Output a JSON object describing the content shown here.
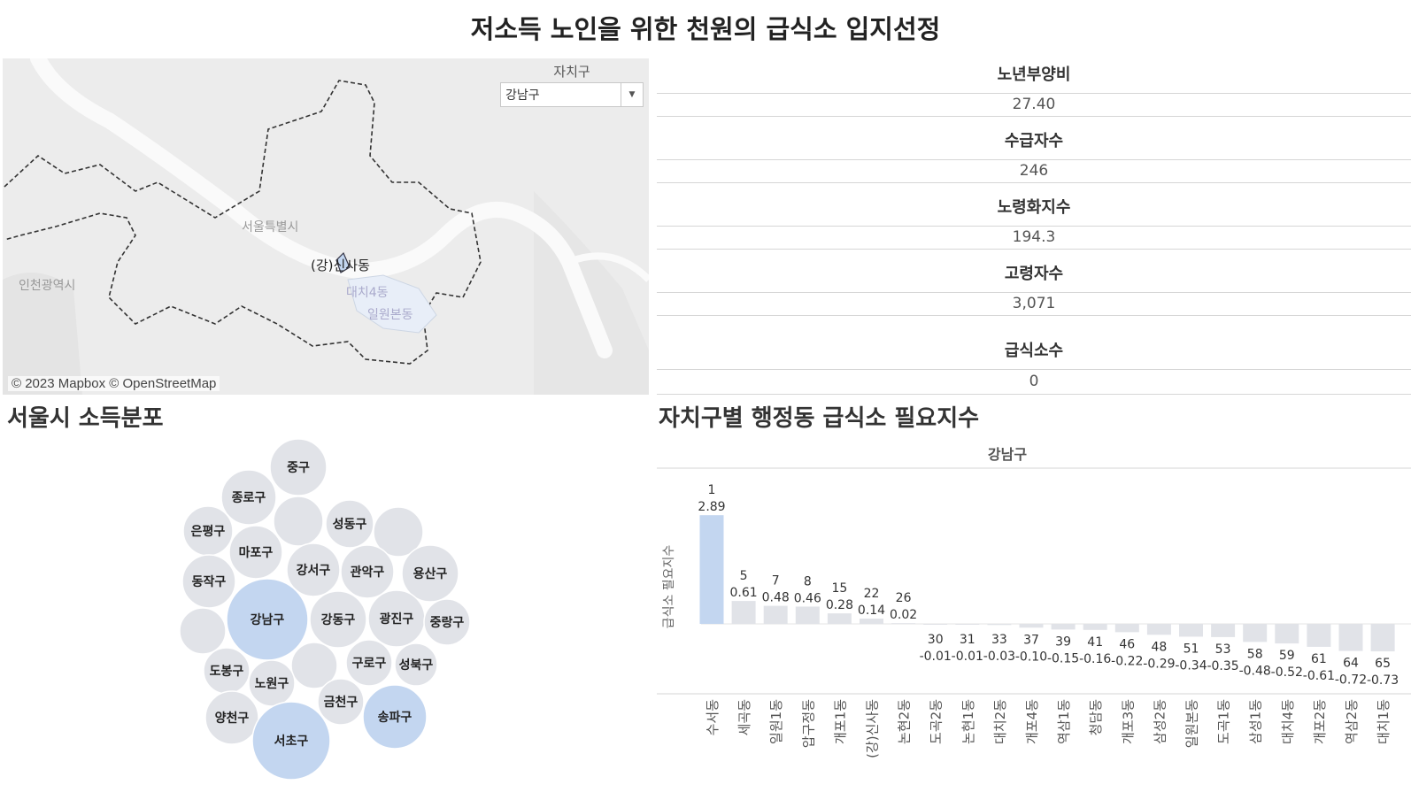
{
  "title": "저소득 노인을 위한 천원의 급식소 입지선정",
  "map": {
    "attribution": "© 2023 Mapbox © OpenStreetMap",
    "labels": {
      "seoul": "서울특별시",
      "incheon": "인천광역시",
      "selected": "(강)신사동",
      "daechi": "대치4동",
      "irwon": "일원본동"
    },
    "filter": {
      "label": "자치구",
      "value": "강남구"
    }
  },
  "stats": [
    {
      "label": "노년부양비",
      "value": "27.40"
    },
    {
      "label": "수급자수",
      "value": "246"
    },
    {
      "label": "노령화지수",
      "value": "194.3"
    },
    {
      "label": "고령자수",
      "value": "3,071"
    },
    {
      "label": "급식소수",
      "value": "0"
    }
  ],
  "bubble_title": "서울시 소득분포",
  "bubbles": [
    {
      "name": "중구",
      "highlight": false
    },
    {
      "name": "종로구",
      "highlight": false
    },
    {
      "name": "",
      "highlight": false
    },
    {
      "name": "성동구",
      "highlight": false
    },
    {
      "name": "",
      "highlight": false
    },
    {
      "name": "은평구",
      "highlight": false
    },
    {
      "name": "마포구",
      "highlight": false
    },
    {
      "name": "강서구",
      "highlight": false
    },
    {
      "name": "관악구",
      "highlight": false
    },
    {
      "name": "용산구",
      "highlight": false
    },
    {
      "name": "동작구",
      "highlight": false
    },
    {
      "name": "강남구",
      "highlight": true
    },
    {
      "name": "강동구",
      "highlight": false
    },
    {
      "name": "광진구",
      "highlight": false
    },
    {
      "name": "중랑구",
      "highlight": false
    },
    {
      "name": "",
      "highlight": false
    },
    {
      "name": "",
      "highlight": false
    },
    {
      "name": "구로구",
      "highlight": false
    },
    {
      "name": "성북구",
      "highlight": false
    },
    {
      "name": "도봉구",
      "highlight": false
    },
    {
      "name": "노원구",
      "highlight": false
    },
    {
      "name": "금천구",
      "highlight": false
    },
    {
      "name": "양천구",
      "highlight": false
    },
    {
      "name": "송파구",
      "highlight": true
    },
    {
      "name": "서초구",
      "highlight": true
    }
  ],
  "chart_title": "자치구별 행정동 급식소 필요지수",
  "chart_data": {
    "type": "bar",
    "panel_header": "강남구",
    "ylabel": "급식소 필요지수",
    "categories": [
      "수서동",
      "세곡동",
      "일원1동",
      "압구정동",
      "개포1동",
      "(강)신사동",
      "논현2동",
      "도곡2동",
      "논현1동",
      "대치2동",
      "개포4동",
      "역삼1동",
      "청담동",
      "개포3동",
      "삼성2동",
      "일원본동",
      "도곡1동",
      "삼성1동",
      "대치4동",
      "개포2동",
      "역삼2동",
      "대치1동"
    ],
    "ranks": [
      1,
      5,
      7,
      8,
      15,
      22,
      26,
      30,
      31,
      33,
      37,
      39,
      41,
      46,
      48,
      51,
      53,
      58,
      59,
      61,
      64,
      65
    ],
    "values": [
      2.89,
      0.61,
      0.48,
      0.46,
      0.28,
      0.14,
      0.02,
      -0.01,
      -0.01,
      -0.03,
      -0.1,
      -0.15,
      -0.16,
      -0.22,
      -0.29,
      -0.34,
      -0.35,
      -0.48,
      -0.52,
      -0.61,
      -0.72,
      -0.73
    ],
    "value_labels": [
      "2.89",
      "0.61",
      "0.48",
      "0.46",
      "0.28",
      "0.14",
      "0.02",
      "-0.01",
      "-0.01",
      "-0.03",
      "-0.10",
      "-0.15",
      "-0.16",
      "-0.22",
      "-0.29",
      "-0.34",
      "-0.35",
      "-0.48",
      "-0.52",
      "-0.61",
      "-0.72",
      "-0.73"
    ],
    "highlight_index": 0,
    "colors": {
      "highlight": "#c3d6f0",
      "bar": "#e1e3e8"
    }
  }
}
